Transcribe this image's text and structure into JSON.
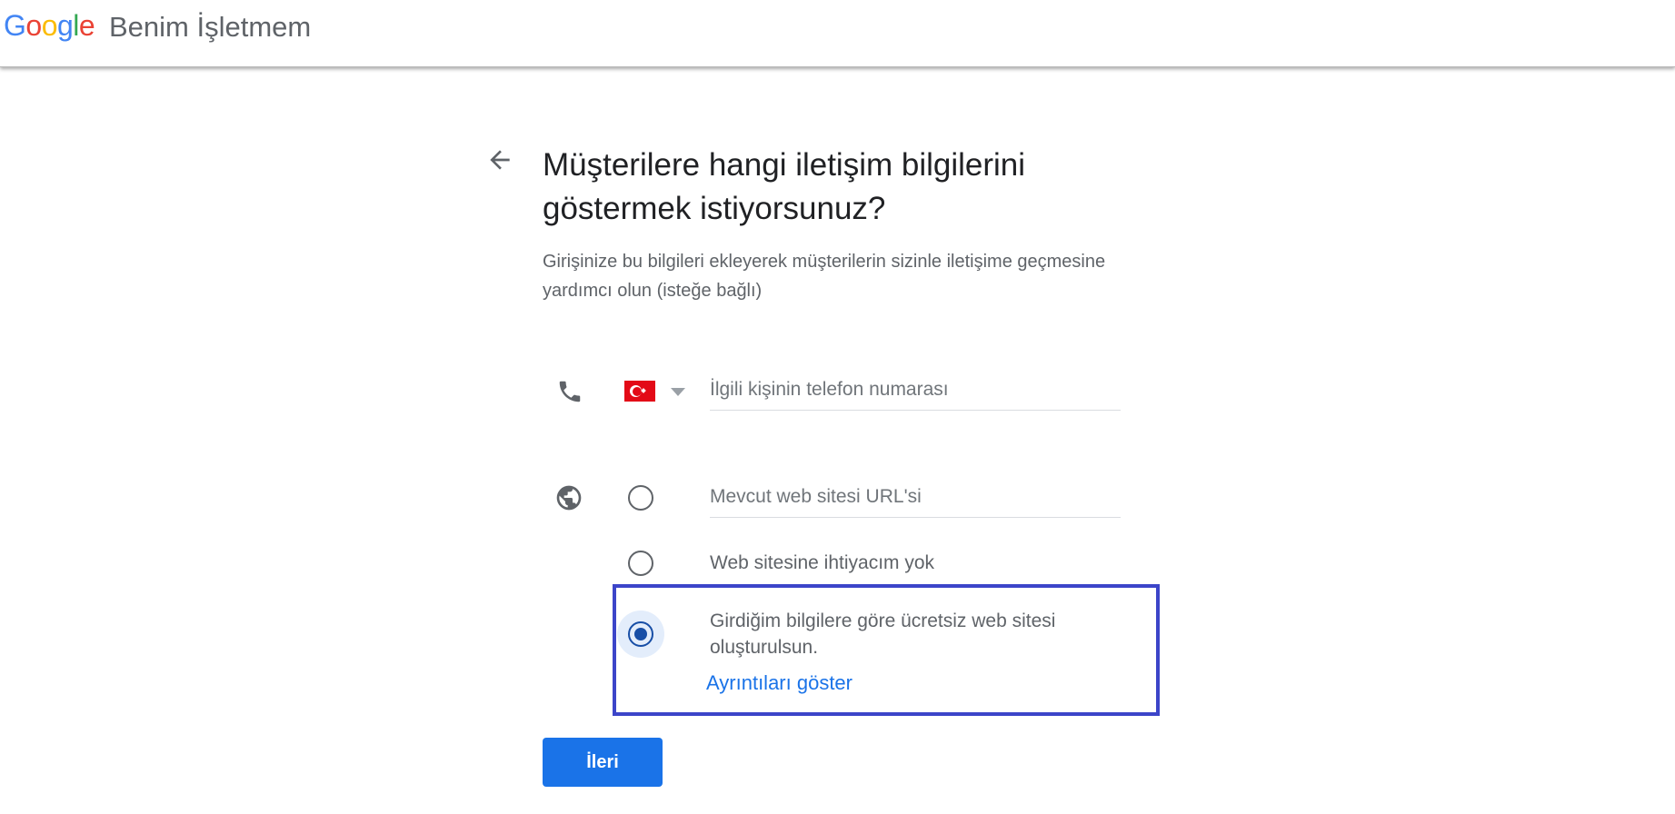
{
  "header": {
    "logo": "Google",
    "product": "Benim İşletmem"
  },
  "page": {
    "title": "Müşterilere hangi iletişim bilgilerini göstermek istiyorsunuz?",
    "subtitle": "Girişinize bu bilgileri ekleyerek müşterilerin sizinle iletişime geçmesine yardımcı olun (isteğe bağlı)"
  },
  "phone": {
    "placeholder": "İlgili kişinin telefon numarası",
    "country": "TR"
  },
  "website": {
    "options": [
      {
        "label": "Mevcut web sitesi URL'si",
        "selected": false
      },
      {
        "label": "Web sitesine ihtiyacım yok",
        "selected": false
      },
      {
        "label": "Girdiğim bilgilere göre ücretsiz web sitesi oluşturulsun.",
        "selected": true
      }
    ],
    "details_link": "Ayrıntıları göster"
  },
  "next_button": "İleri",
  "colors": {
    "accent": "#1a73e8",
    "highlight": "#3c45c9"
  }
}
